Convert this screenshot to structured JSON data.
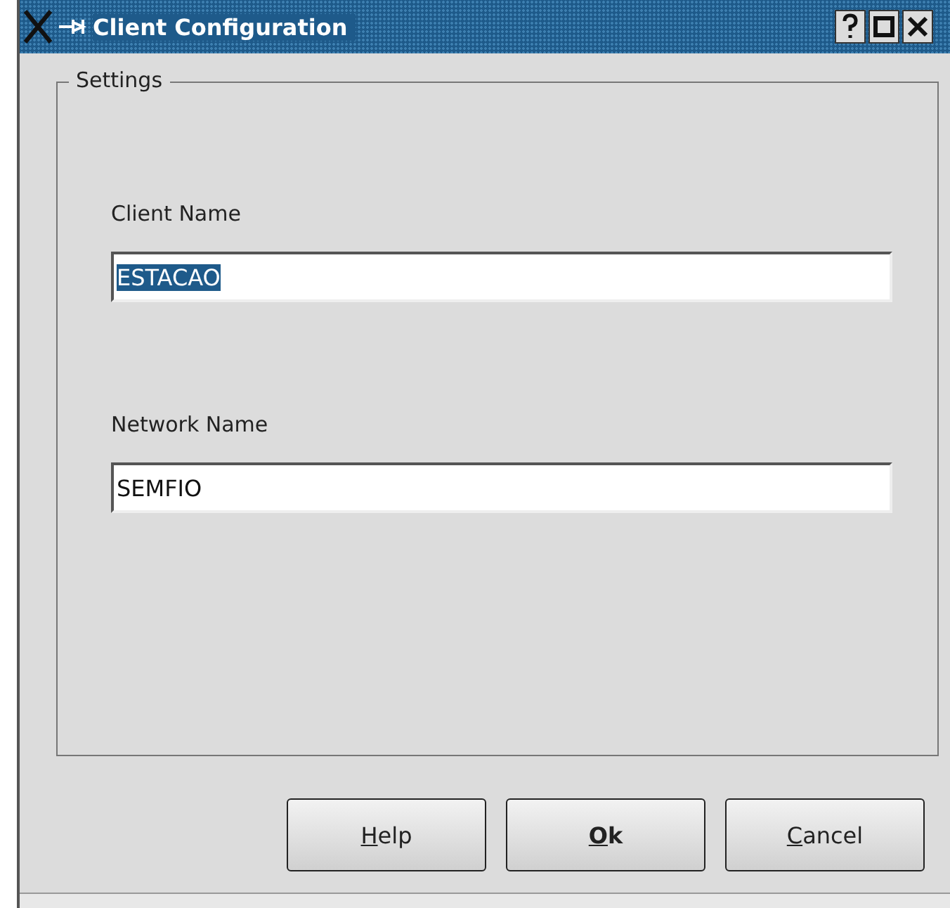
{
  "window": {
    "title": "Client Configuration"
  },
  "group": {
    "title": "Settings"
  },
  "fields": [
    {
      "label": "Client Name",
      "value": "ESTACAO",
      "text_selected": true
    },
    {
      "label": "Network Name",
      "value": "SEMFIO",
      "text_selected": false
    }
  ],
  "buttons": [
    {
      "label": "Help",
      "first_letter_underlined": true,
      "default": false
    },
    {
      "label": "Ok",
      "first_letter_underlined": true,
      "default": true
    },
    {
      "label": "Cancel",
      "first_letter_underlined": true,
      "default": false
    }
  ]
}
